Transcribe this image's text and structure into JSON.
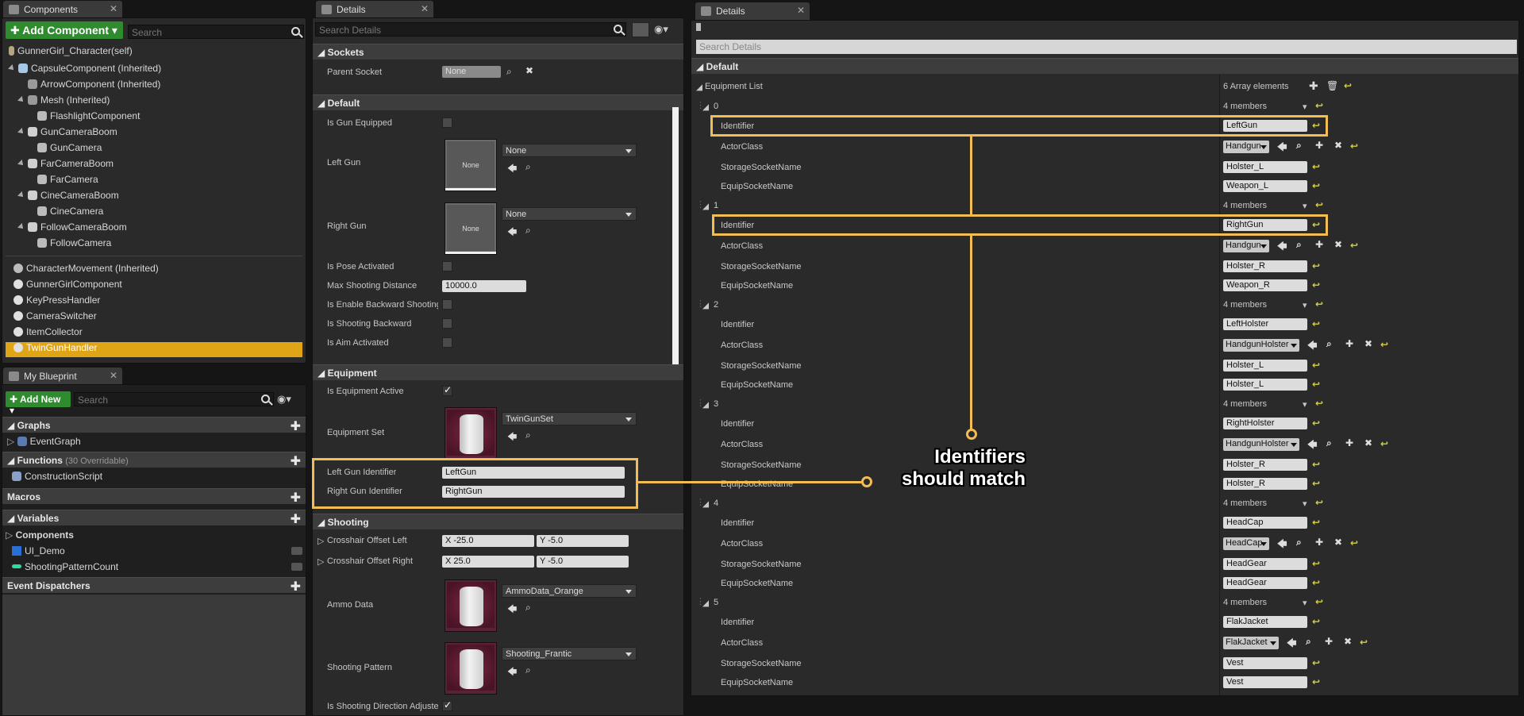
{
  "components": {
    "tab": "Components",
    "add_component": "Add Component",
    "search_placeholder": "Search",
    "root": "GunnerGirl_Character(self)",
    "tree": [
      {
        "label": "CapsuleComponent (Inherited)",
        "level": 0,
        "exp": true
      },
      {
        "label": "ArrowComponent (Inherited)",
        "level": 1,
        "exp": false
      },
      {
        "label": "Mesh (Inherited)",
        "level": 1,
        "exp": true
      },
      {
        "label": "FlashlightComponent",
        "level": 2,
        "exp": false
      },
      {
        "label": "GunCameraBoom",
        "level": 1,
        "exp": true
      },
      {
        "label": "GunCamera",
        "level": 2,
        "exp": false
      },
      {
        "label": "FarCameraBoom",
        "level": 1,
        "exp": true
      },
      {
        "label": "FarCamera",
        "level": 2,
        "exp": false
      },
      {
        "label": "CineCameraBoom",
        "level": 1,
        "exp": true
      },
      {
        "label": "CineCamera",
        "level": 2,
        "exp": false
      },
      {
        "label": "FollowCameraBoom",
        "level": 1,
        "exp": true
      },
      {
        "label": "FollowCamera",
        "level": 2,
        "exp": false
      }
    ],
    "others": [
      "CharacterMovement (Inherited)",
      "GunnerGirlComponent",
      "KeyPressHandler",
      "CameraSwitcher",
      "ItemCollector",
      "TwinGunHandler"
    ],
    "selected": "TwinGunHandler"
  },
  "blueprint": {
    "tab": "My Blueprint",
    "add_new": "Add New",
    "search_placeholder": "Search",
    "graphs": "Graphs",
    "event_graph": "EventGraph",
    "functions": "Functions",
    "functions_count": "(30 Overridable)",
    "construction_script": "ConstructionScript",
    "macros": "Macros",
    "variables": "Variables",
    "components_label": "Components",
    "vars": [
      "UI_Demo",
      "ShootingPatternCount"
    ],
    "event_dispatchers": "Event Dispatchers"
  },
  "details1": {
    "tab": "Details",
    "search_placeholder": "Search Details",
    "sockets": "Sockets",
    "parent_socket": "Parent Socket",
    "parent_socket_value": "None",
    "default": "Default",
    "is_gun_equipped": "Is Gun Equipped",
    "left_gun": "Left Gun",
    "left_gun_thumb": "None",
    "left_gun_value": "None",
    "right_gun": "Right Gun",
    "right_gun_thumb": "None",
    "right_gun_value": "None",
    "is_pose_activated": "Is Pose Activated",
    "max_shooting_distance": "Max Shooting Distance",
    "max_shooting_distance_value": "10000.0",
    "is_enable_backward": "Is Enable Backward Shooting",
    "is_shooting_backward": "Is Shooting Backward",
    "is_aim_activated": "Is Aim Activated",
    "equipment": "Equipment",
    "is_equipment_active": "Is Equipment Active",
    "equipment_set": "Equipment Set",
    "equipment_set_value": "TwinGunSet",
    "left_gun_identifier": "Left Gun Identifier",
    "left_gun_identifier_value": "LeftGun",
    "right_gun_identifier": "Right Gun Identifier",
    "right_gun_identifier_value": "RightGun",
    "shooting": "Shooting",
    "crosshair_left": "Crosshair Offset Left",
    "crosshair_left_x": "X  -25.0",
    "crosshair_left_y": "Y  -5.0",
    "crosshair_right": "Crosshair Offset Right",
    "crosshair_right_x": "X  25.0",
    "crosshair_right_y": "Y  -5.0",
    "ammo_data": "Ammo Data",
    "ammo_data_value": "AmmoData_Orange",
    "shooting_pattern": "Shooting Pattern",
    "shooting_pattern_value": "Shooting_Frantic",
    "is_shooting_direction": "Is Shooting Direction Adjusted"
  },
  "details2": {
    "tab": "Details",
    "search_placeholder": "Search Details",
    "default": "Default",
    "equipment_list": "Equipment List",
    "array_count": "6 Array elements",
    "members_label": "4 members",
    "field_identifier": "Identifier",
    "field_actor_class": "ActorClass",
    "field_storage": "StorageSocketName",
    "field_equip": "EquipSocketName",
    "elements": [
      {
        "index": "0",
        "identifier": "LeftGun",
        "actor_class": "Handgun",
        "storage": "Holster_L",
        "equip": "Weapon_L"
      },
      {
        "index": "1",
        "identifier": "RightGun",
        "actor_class": "Handgun",
        "storage": "Holster_R",
        "equip": "Weapon_R"
      },
      {
        "index": "2",
        "identifier": "LeftHolster",
        "actor_class": "HandgunHolster",
        "storage": "Holster_L",
        "equip": "Holster_L"
      },
      {
        "index": "3",
        "identifier": "RightHolster",
        "actor_class": "HandgunHolster",
        "storage": "Holster_R",
        "equip": "Holster_R"
      },
      {
        "index": "4",
        "identifier": "HeadCap",
        "actor_class": "HeadCap",
        "storage": "HeadGear",
        "equip": "HeadGear"
      },
      {
        "index": "5",
        "identifier": "FlakJacket",
        "actor_class": "FlakJacket",
        "storage": "Vest",
        "equip": "Vest"
      }
    ]
  },
  "annotation": {
    "line1": "Identifiers",
    "line2": "should match",
    "color": "#f2bd53"
  }
}
